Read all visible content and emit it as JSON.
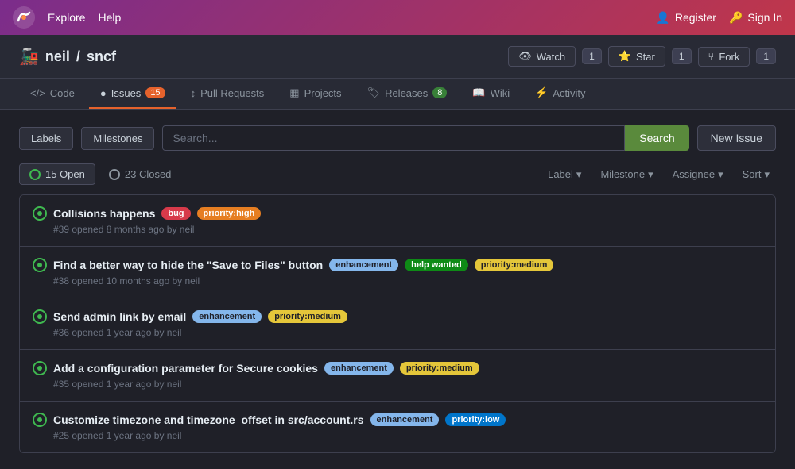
{
  "topnav": {
    "links": [
      {
        "label": "Explore",
        "id": "explore"
      },
      {
        "label": "Help",
        "id": "help"
      }
    ],
    "right": [
      {
        "label": "Register",
        "icon": "user-icon",
        "id": "register"
      },
      {
        "label": "Sign In",
        "icon": "signin-icon",
        "id": "signin"
      }
    ]
  },
  "repo": {
    "emoji": "🚂",
    "owner": "neil",
    "name": "sncf",
    "actions": [
      {
        "label": "Watch",
        "count": "1",
        "icon": "eye-icon"
      },
      {
        "label": "Star",
        "count": "1",
        "icon": "star-icon"
      },
      {
        "label": "Fork",
        "count": "1",
        "icon": "fork-icon"
      }
    ]
  },
  "tabs": [
    {
      "label": "Code",
      "icon": "code-icon",
      "active": false
    },
    {
      "label": "Issues",
      "badge": "15",
      "icon": "issue-icon",
      "active": true
    },
    {
      "label": "Pull Requests",
      "icon": "pr-icon",
      "active": false
    },
    {
      "label": "Projects",
      "icon": "project-icon",
      "active": false
    },
    {
      "label": "Releases",
      "badge": "8",
      "icon": "tag-icon",
      "active": false
    },
    {
      "label": "Wiki",
      "icon": "wiki-icon",
      "active": false
    },
    {
      "label": "Activity",
      "icon": "activity-icon",
      "active": false
    }
  ],
  "filter": {
    "labels_btn": "Labels",
    "milestones_btn": "Milestones",
    "search_placeholder": "Search...",
    "search_btn": "Search",
    "new_issue_btn": "New Issue"
  },
  "status": {
    "open_label": "15 Open",
    "closed_label": "23 Closed",
    "dropdowns": [
      "Label",
      "Milestone",
      "Assignee",
      "Sort"
    ]
  },
  "issues": [
    {
      "id": 1,
      "title": "Collisions happens",
      "number": "#39",
      "meta": "opened 8 months ago by neil",
      "badges": [
        {
          "label": "bug",
          "type": "bug"
        },
        {
          "label": "priority:high",
          "type": "priority-high"
        }
      ]
    },
    {
      "id": 2,
      "title": "Find a better way to hide the \"Save to Files\" button",
      "number": "#38",
      "meta": "opened 10 months ago by neil",
      "badges": [
        {
          "label": "enhancement",
          "type": "enhancement"
        },
        {
          "label": "help wanted",
          "type": "help-wanted"
        },
        {
          "label": "priority:medium",
          "type": "priority-medium"
        }
      ]
    },
    {
      "id": 3,
      "title": "Send admin link by email",
      "number": "#36",
      "meta": "opened 1 year ago by neil",
      "badges": [
        {
          "label": "enhancement",
          "type": "enhancement"
        },
        {
          "label": "priority:medium",
          "type": "priority-medium"
        }
      ]
    },
    {
      "id": 4,
      "title": "Add a configuration parameter for Secure cookies",
      "number": "#35",
      "meta": "opened 1 year ago by neil",
      "badges": [
        {
          "label": "enhancement",
          "type": "enhancement"
        },
        {
          "label": "priority:medium",
          "type": "priority-medium"
        }
      ]
    },
    {
      "id": 5,
      "title": "Customize timezone and timezone_offset in src/account.rs",
      "number": "#25",
      "meta": "opened 1 year ago by neil",
      "badges": [
        {
          "label": "enhancement",
          "type": "enhancement"
        },
        {
          "label": "priority:low",
          "type": "priority-low"
        }
      ]
    }
  ]
}
